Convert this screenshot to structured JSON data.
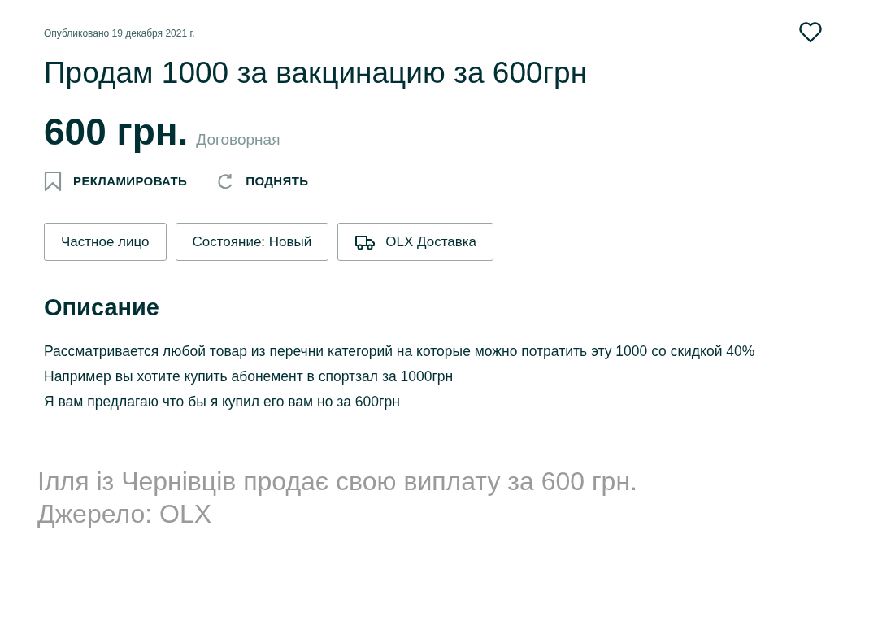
{
  "listing": {
    "published": "Опубликовано 19 декабря 2021 г.",
    "title": "Продам 1000 за вакцинацию за 600грн",
    "price": "600 грн.",
    "price_note": "Договорная",
    "actions": [
      {
        "kind": "promote",
        "label": "РЕКЛАМИРОВАТЬ"
      },
      {
        "kind": "raise",
        "label": "ПОДНЯТЬ"
      }
    ],
    "tags": [
      {
        "kind": "plain",
        "label": "Частное лицо"
      },
      {
        "kind": "plain",
        "label": "Состояние: Новый"
      },
      {
        "kind": "delivery",
        "label": "OLX Доставка"
      }
    ],
    "description_heading": "Описание",
    "description": [
      "Рассматривается любой товар из перечни категорий на которые можно потратить эту 1000 со скидкой 40%",
      "Например вы хотите купить абонемент в спортзал за 1000грн",
      "Я вам предлагаю что бы я купил его вам но за 600грн"
    ]
  },
  "caption": [
    "Ілля із Чернівців продає свою виплату за 600 грн.",
    "Джерело: OLX"
  ]
}
